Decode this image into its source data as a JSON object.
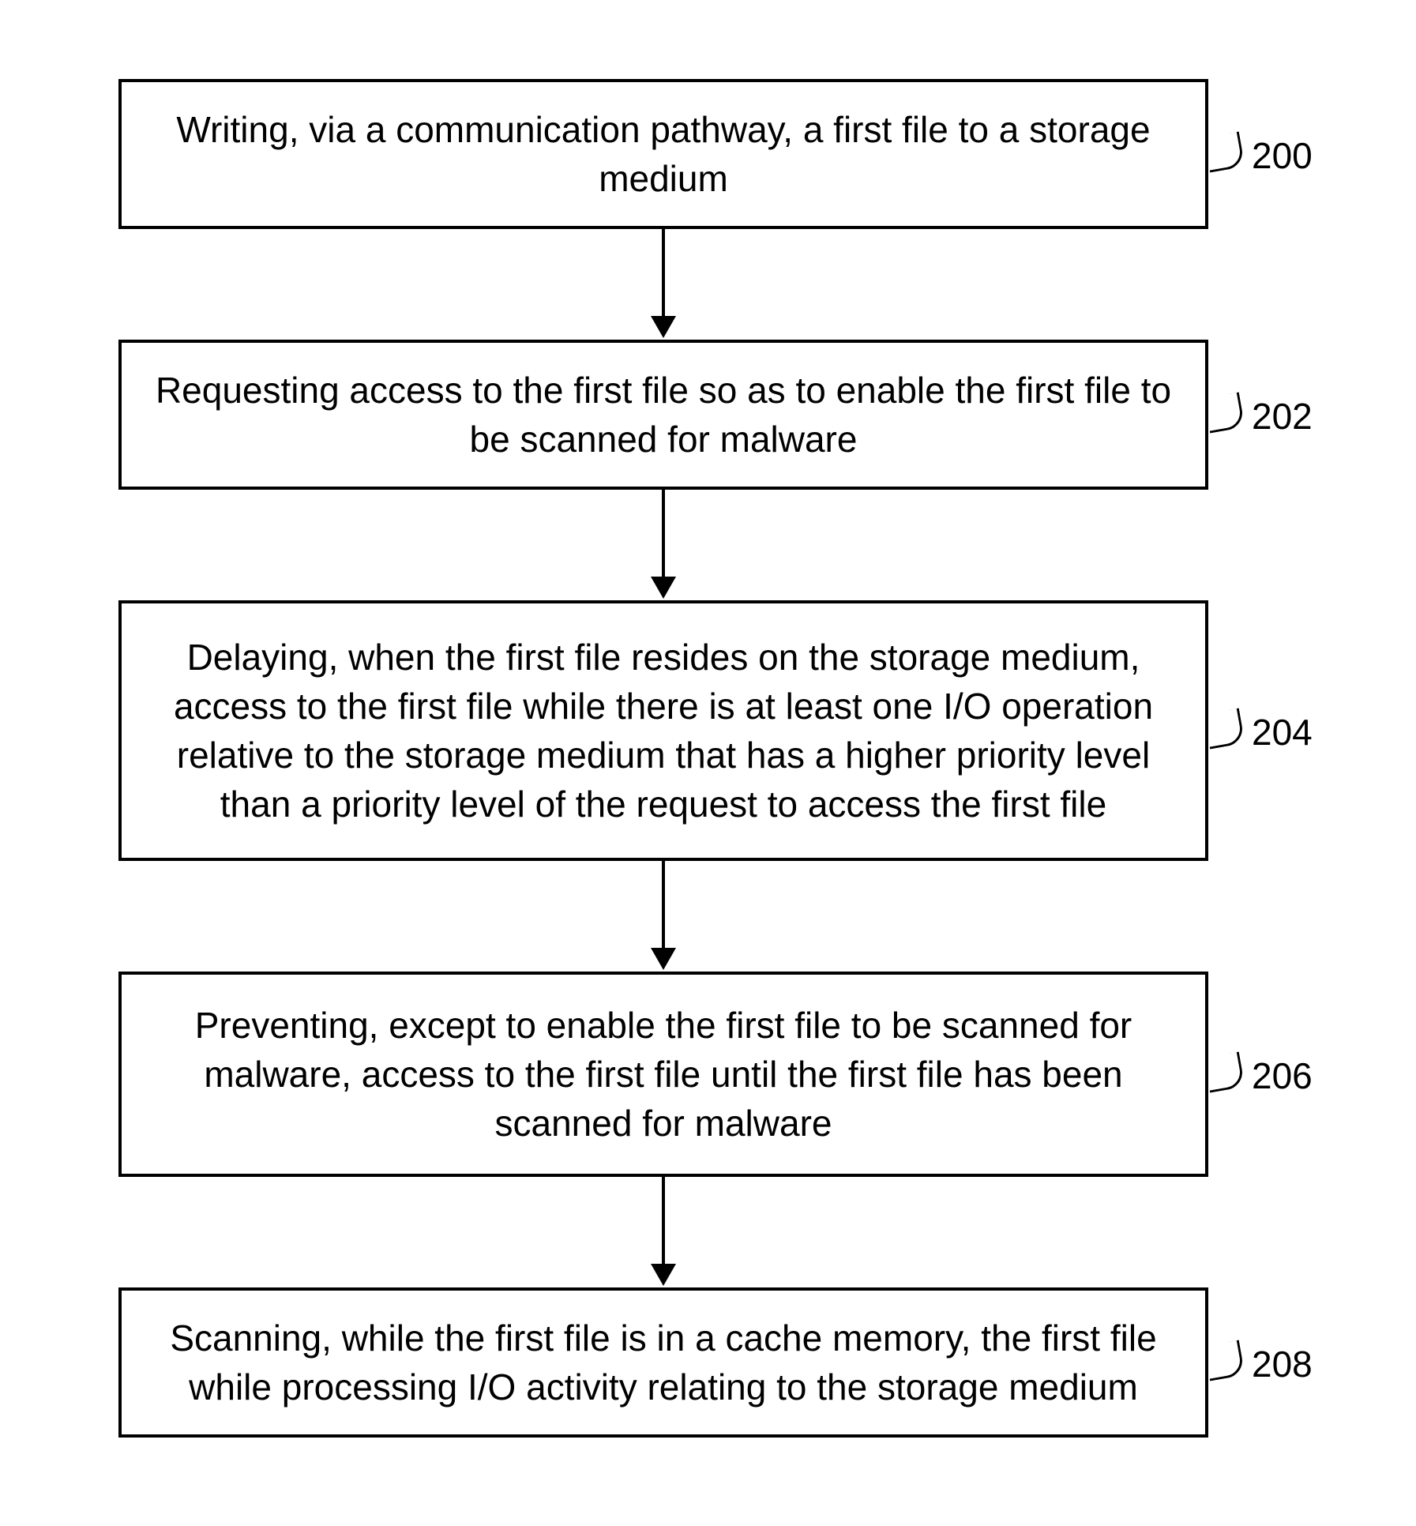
{
  "flowchart": {
    "steps": [
      {
        "text": "Writing, via a communication pathway, a first file to a storage medium",
        "label": "200"
      },
      {
        "text": "Requesting access to the first file so as to enable the first file to be scanned for malware",
        "label": "202"
      },
      {
        "text": "Delaying, when the first file resides on the storage medium, access to the first file while there is at least one I/O operation relative to the storage medium that has a higher priority level than a priority level of the request to access the first file",
        "label": "204"
      },
      {
        "text": "Preventing, except to enable the first file to be scanned for malware, access to the first file until the first file has been scanned for malware",
        "label": "206"
      },
      {
        "text": "Scanning, while the first file is in a cache memory, the first file while processing I/O activity relating to the storage medium",
        "label": "208"
      }
    ]
  }
}
